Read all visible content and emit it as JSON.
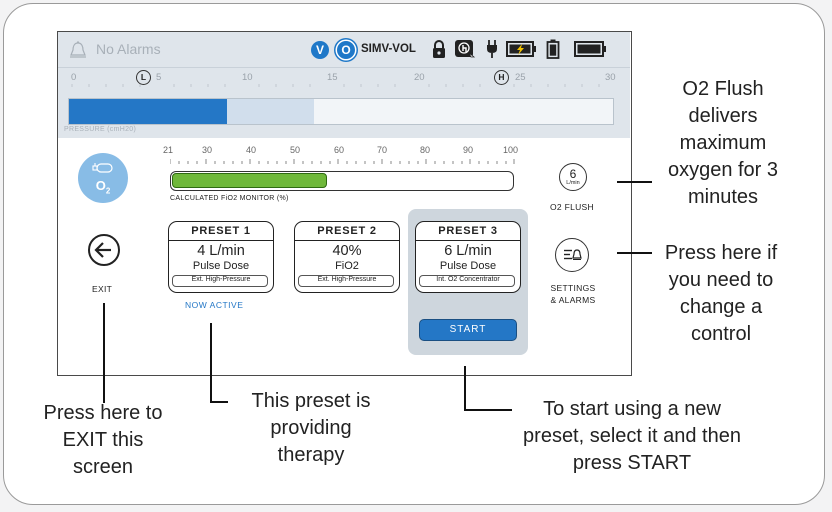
{
  "status_bar": {
    "alarm_text": "No Alarms",
    "breath_badge": "V",
    "oxygen_badge": "O",
    "mode": "SIMV-VOL"
  },
  "pressure_scale": {
    "ticks": [
      "0",
      "5",
      "10",
      "15",
      "20",
      "25",
      "30"
    ],
    "low_marker": "L",
    "high_marker": "H",
    "label": "PRESSURE (cmH20)",
    "current_fraction": 0.29,
    "peak_fraction": 0.45
  },
  "o2": {
    "symbol": "O",
    "subscript": "2"
  },
  "fio2_monitor": {
    "ticks": [
      "21",
      "30",
      "40",
      "50",
      "60",
      "70",
      "80",
      "90",
      "100"
    ],
    "label": "CALCULATED FiO2 MONITOR (%)",
    "value_percent": 57
  },
  "o2_flush": {
    "value": "6",
    "unit": "L/min",
    "label": "O2 FLUSH"
  },
  "exit": {
    "label": "EXIT"
  },
  "settings": {
    "label_line1": "SETTINGS",
    "label_line2": "& ALARMS"
  },
  "presets": [
    {
      "title": "PRESET 1",
      "value": "4 L/min",
      "mode": "Pulse Dose",
      "source": "Ext. High-Pressure"
    },
    {
      "title": "PRESET 2",
      "value": "40%",
      "mode": "FiO2",
      "source": "Ext. High-Pressure"
    },
    {
      "title": "PRESET 3",
      "value": "6 L/min",
      "mode": "Pulse Dose",
      "source": "Int. O2 Concentrator"
    }
  ],
  "now_active": "NOW ACTIVE",
  "start_label": "START",
  "callouts": {
    "o2_flush_lines": [
      "O2 Flush",
      "delivers",
      "maximum",
      "oxygen for 3",
      "minutes"
    ],
    "settings_lines": [
      "Press here if",
      "you need to",
      "change a",
      "control"
    ],
    "exit_lines": [
      "Press here to",
      "EXIT this",
      "screen"
    ],
    "active_lines": [
      "This preset is",
      "providing",
      "therapy"
    ],
    "start_lines": [
      "To start using a new",
      "preset, select it and then",
      "press START"
    ]
  },
  "colors": {
    "accent": "#2477c6",
    "fio2_fill": "#6fb83a",
    "status_bar": "#dfe5eb",
    "o2_button": "#88bce6"
  }
}
